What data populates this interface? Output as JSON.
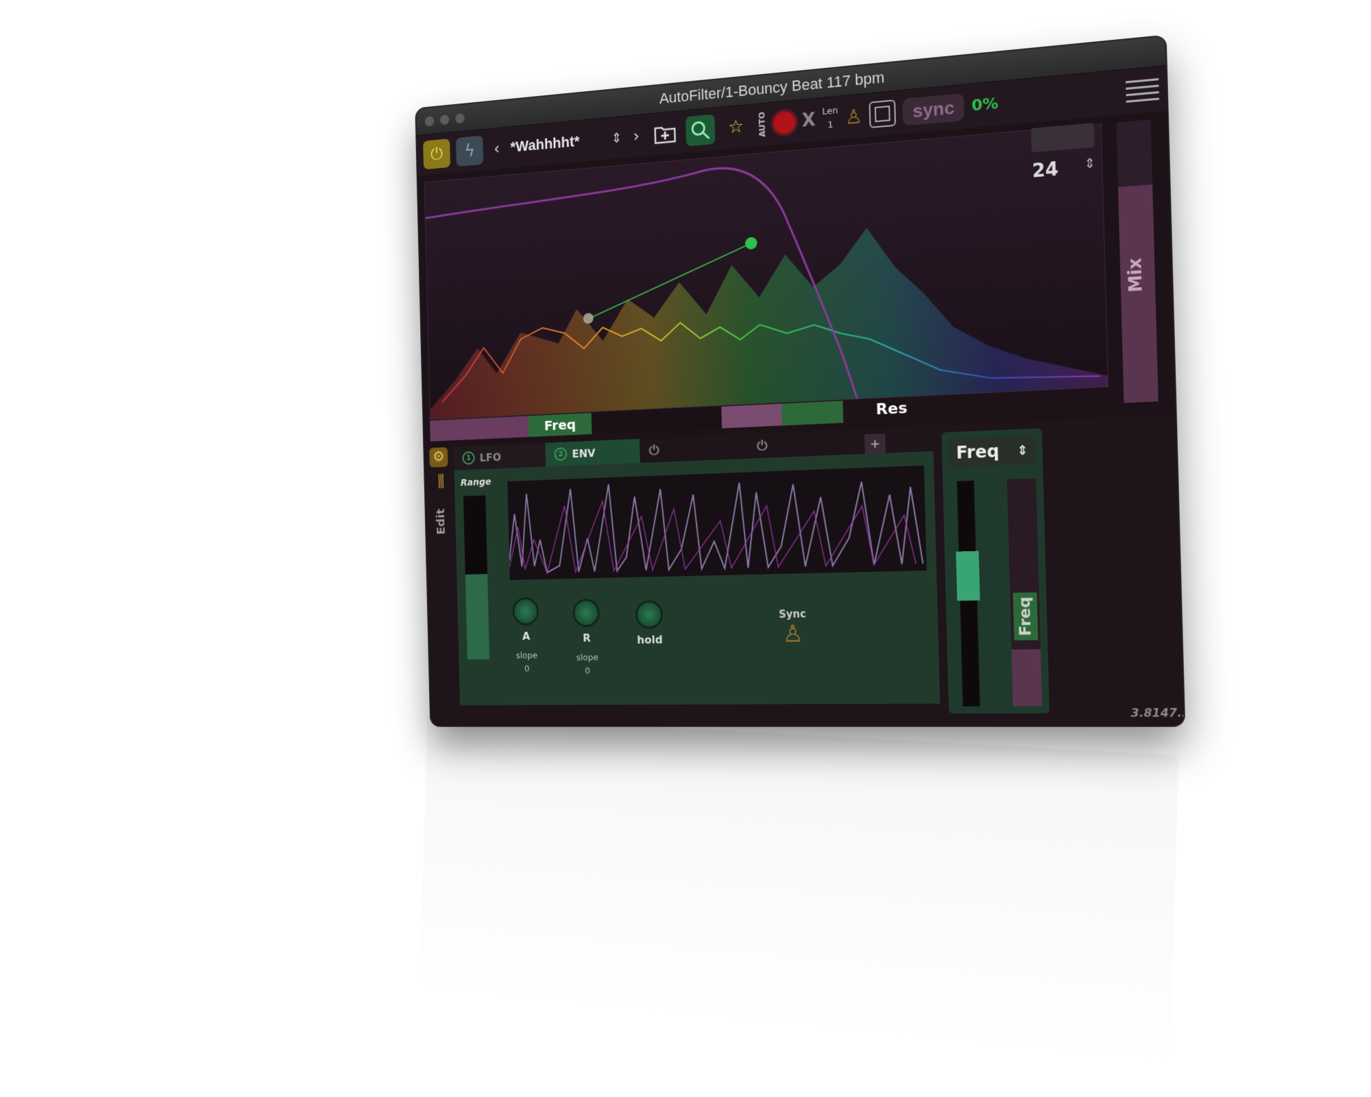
{
  "window": {
    "title": "AutoFilter/1-Bouncy Beat 117 bpm"
  },
  "toolbar": {
    "power_icon": "power-icon",
    "bolt_icon": "bolt-icon",
    "prev": "‹",
    "next": "›",
    "preset_name": "*Wahhhht*",
    "preset_updown": "⇕",
    "auto_label": "AUTO",
    "clear_label": "X",
    "len_label": "Len",
    "len_value": "1",
    "sync_label": "sync",
    "sync_percent": "0%"
  },
  "filter": {
    "slope_value": "24",
    "mix_label": "Mix",
    "freq_label": "Freq",
    "res_label": "Res"
  },
  "mod": {
    "edit_label": "Edit",
    "tab_lfo_num": "1",
    "tab_lfo": "LFO",
    "tab_env_num": "2",
    "tab_env": "ENV",
    "add_label": "+",
    "range_label": "Range",
    "knob_a": "A",
    "knob_r": "R",
    "knob_hold": "hold",
    "slope_label": "slope",
    "slope_a_value": "0",
    "slope_r_value": "0",
    "sync_label": "Sync",
    "dest_label": "Freq",
    "freq_strip_label": "Freq",
    "version": "3.8147..."
  },
  "colors": {
    "accent_green": "#2fbf4f",
    "accent_purple": "#8a3a9a",
    "record_red": "#b3121b"
  }
}
